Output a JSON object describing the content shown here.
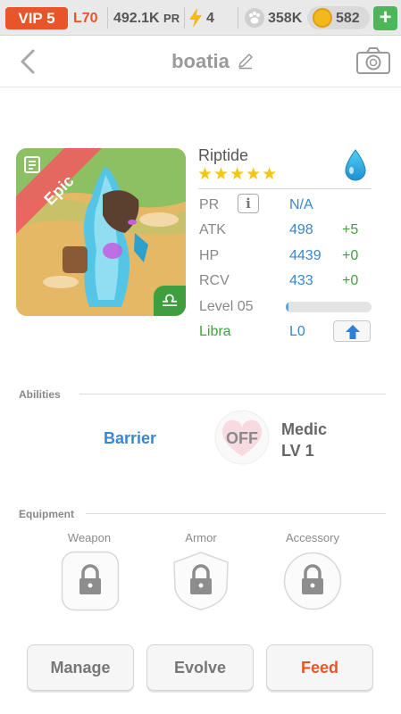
{
  "topbar": {
    "vip": "VIP 5",
    "level": "L70",
    "pr_value": "492.1K",
    "pr_unit": "PR",
    "energy": "4",
    "paw_count": "358K",
    "coins": "582",
    "plus": "+"
  },
  "header": {
    "title": "boatia"
  },
  "creature": {
    "name": "Riptide",
    "rarity": "Epic",
    "stars": "★★★★★",
    "element_icon": "water-drop-icon",
    "zodiac_glyph": "♎",
    "stats": {
      "pr_label": "PR",
      "pr_value": "N/A",
      "info_glyph": "i",
      "atk_label": "ATK",
      "atk_value": "498",
      "atk_bonus": "+5",
      "hp_label": "HP",
      "hp_value": "4439",
      "hp_bonus": "+0",
      "rcv_label": "RCV",
      "rcv_value": "433",
      "rcv_bonus": "+0",
      "level_label": "Level 05",
      "level_progress": 0.03,
      "zodiac_label": "Libra",
      "zodiac_level": "L0"
    }
  },
  "abilities": {
    "title": "Abilities",
    "active_name": "Barrier",
    "passive_status": "OFF",
    "passive_name": "Medic",
    "passive_level": "LV 1"
  },
  "equipment": {
    "title": "Equipment",
    "weapon": "Weapon",
    "armor": "Armor",
    "accessory": "Accessory"
  },
  "actions": {
    "manage": "Manage",
    "evolve": "Evolve",
    "feed": "Feed"
  },
  "colors": {
    "accent_orange": "#e8552b",
    "stat_blue": "#3a86d0",
    "bonus_green": "#3ea33c",
    "star_gold": "#f5c60b"
  }
}
